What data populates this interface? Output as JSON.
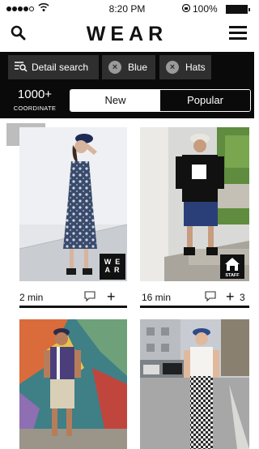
{
  "status": {
    "time": "8:20 PM",
    "battery": "100%"
  },
  "nav": {
    "title": "WEAR"
  },
  "filters": {
    "detail_search": "Detail search",
    "chips": [
      "Blue",
      "Hats"
    ]
  },
  "summary": {
    "count": "1000+",
    "count_label": "COORDINATE",
    "tabs": [
      "New",
      "Popular"
    ],
    "active_tab": "New"
  },
  "posts": [
    {
      "time": "2 min",
      "likes": "",
      "badge": "wear",
      "badge_text": "W E A R"
    },
    {
      "time": "16 min",
      "likes": "3",
      "badge": "staff",
      "badge_text": "STAFF"
    },
    {
      "time": "",
      "likes": "",
      "badge": "",
      "badge_text": ""
    },
    {
      "time": "",
      "likes": "",
      "badge": "",
      "badge_text": ""
    }
  ],
  "colors": {
    "filterbar": "#0a0a0a",
    "chip": "#2f2f2f",
    "gridtoggle": "#bdbdbd"
  }
}
